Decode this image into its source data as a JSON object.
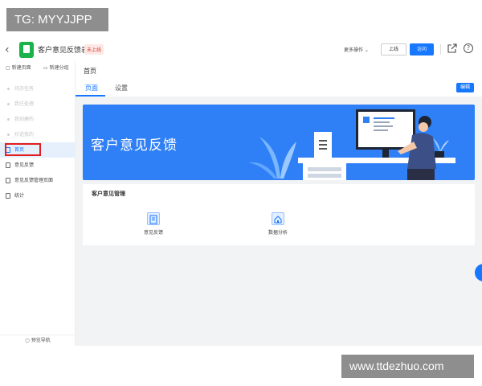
{
  "watermarks": {
    "top": "TG: MYYJJPP",
    "bottom": "www.ttdezhuo.com"
  },
  "topbar": {
    "back_glyph": "‹",
    "app_name": "客户意见反馈表",
    "status_badge": "未上线",
    "more_ops": "更多操作 ⌄",
    "online_label": "上线",
    "visit_label": "访问",
    "help_glyph": "?"
  },
  "sidebar": {
    "new_page": "新建页面",
    "new_group": "新建分组",
    "items": [
      {
        "label": "待办任务",
        "faded": true
      },
      {
        "label": "我已处理",
        "faded": true
      },
      {
        "label": "我创建的",
        "faded": true
      },
      {
        "label": "抄送我的",
        "faded": true
      },
      {
        "label": "首页",
        "active": true
      },
      {
        "label": "意见反馈"
      },
      {
        "label": "意见反馈管理页面"
      },
      {
        "label": "统计"
      }
    ],
    "footer": "预览导航"
  },
  "main": {
    "page_title": "首页",
    "tabs": [
      "页面",
      "设置"
    ],
    "edit_label": "编辑",
    "banner_title": "客户意见反馈",
    "panel_title": "客户意见管理",
    "tiles": [
      {
        "label": "意见反馈",
        "icon": "feedback-form-icon"
      },
      {
        "label": "数据分析",
        "icon": "home-icon"
      }
    ]
  },
  "colors": {
    "primary": "#1677ff",
    "banner": "#2f80f7",
    "logo_green": "#19b24b",
    "badge_red": "#e0382b",
    "highlight_red": "#e02020"
  }
}
